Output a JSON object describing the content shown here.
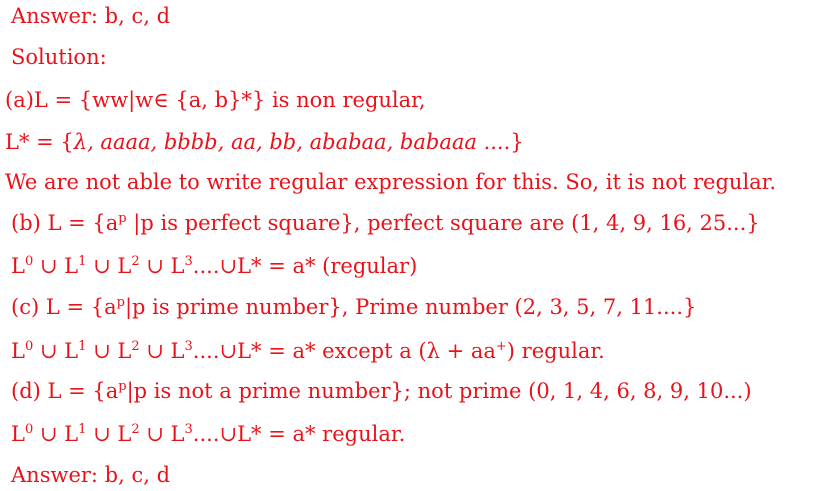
{
  "answer_top": "Answer: b, c, d",
  "solution_heading": "Solution:",
  "a_def": "(a)L = {ww|w∈ {a, b}*} is non regular,",
  "a_lstar_prefix": "L* = {",
  "a_lstar_math": "λ, aaaa, bbbb, aa, bb, ababaa, babaaa ....",
  "a_lstar_suffix": "}",
  "a_explain": "We are not able to write regular expression for this. So, it is not regular.",
  "b_def_pre": "(b) L = {a",
  "b_def_sup": "p",
  "b_def_post": " |p is perfect square}, perfect square are (1, 4, 9, 16, 25...}",
  "b_union": {
    "p0": "L",
    "s0": "0",
    "p1": " ∪ L",
    "s1": "1",
    "p2": " ∪ L",
    "s2": "2",
    "p3": " ∪ L",
    "s3": "3",
    "tail": "....∪L* = a* (regular)"
  },
  "c_def_pre": "(c) L = {a",
  "c_def_sup": "p",
  "c_def_post": "|p is prime number}, Prime number (2, 3, 5, 7, 11....}",
  "c_union": {
    "p0": "L",
    "s0": "0",
    "p1": " ∪ L",
    "s1": "1",
    "p2": " ∪ L",
    "s2": "2",
    "p3": " ∪ L",
    "s3": "3",
    "tail": "....∪L* = a* except a (λ + aa",
    "s4": "+",
    "tail2": ") regular."
  },
  "d_def_pre": "(d) L = {a",
  "d_def_sup": "p",
  "d_def_post": "|p is not a prime number}; not prime (0, 1, 4, 6, 8, 9, 10...)",
  "d_union": {
    "p0": "L",
    "s0": "0",
    "p1": " ∪ L",
    "s1": "1",
    "p2": " ∪ L",
    "s2": "2",
    "p3": " ∪ L",
    "s3": "3",
    "tail": "....∪L* = a* regular."
  },
  "answer_bottom": "Answer: b, c, d",
  "colors": {
    "text": "#e8131a",
    "background": "#ffffff"
  }
}
